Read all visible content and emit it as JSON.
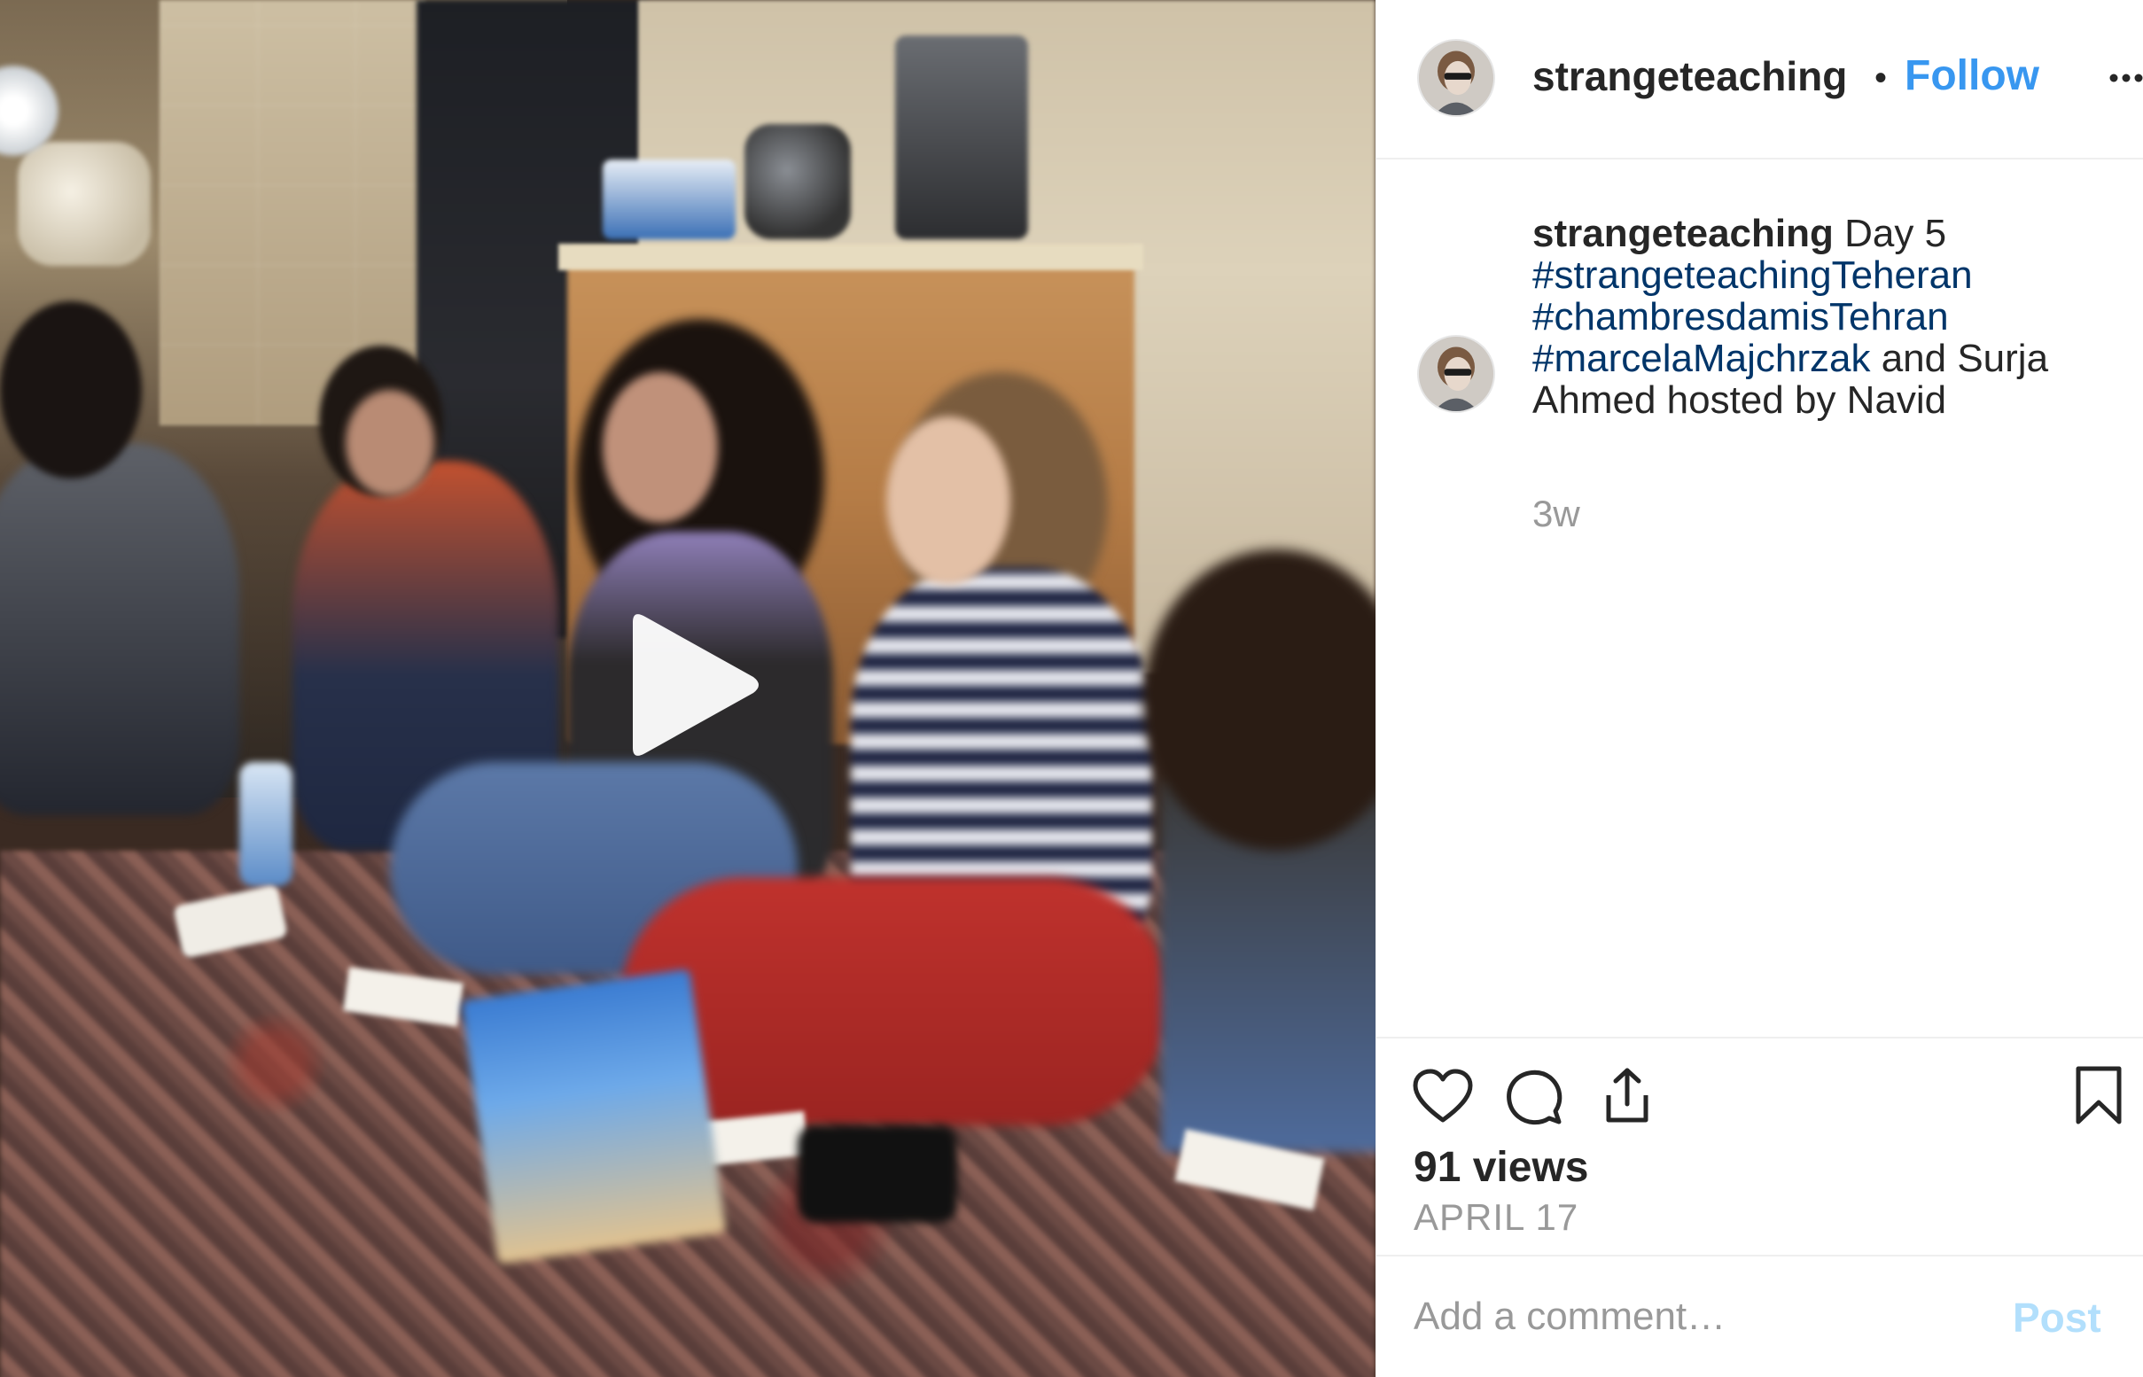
{
  "header": {
    "username": "strangeteaching",
    "separator": "•",
    "follow_label": "Follow",
    "more_icon": "more-horizontal-icon"
  },
  "caption": {
    "username": "strangeteaching",
    "text_start": " Day 5 ",
    "hashtags": [
      "#strangeteachingTeheran",
      "#chambresdamisTehran",
      "#marcelaMajchrzak"
    ],
    "text_end": " and Surja Ahmed hosted by Navid",
    "time_ago": "3w"
  },
  "actions": {
    "like_icon": "heart-icon",
    "comment_icon": "comment-icon",
    "share_icon": "share-icon",
    "save_icon": "bookmark-icon",
    "views": "91 views",
    "date": "APRIL 17"
  },
  "comment_box": {
    "placeholder": "Add a comment…",
    "value": "",
    "post_label": "Post"
  },
  "media": {
    "type": "video",
    "play_icon": "play-icon"
  },
  "colors": {
    "link_blue": "#3897f0",
    "hashtag": "#003569",
    "text": "#262626",
    "muted": "#999999",
    "post_disabled": "#b2dffc",
    "divider": "#efefef"
  }
}
